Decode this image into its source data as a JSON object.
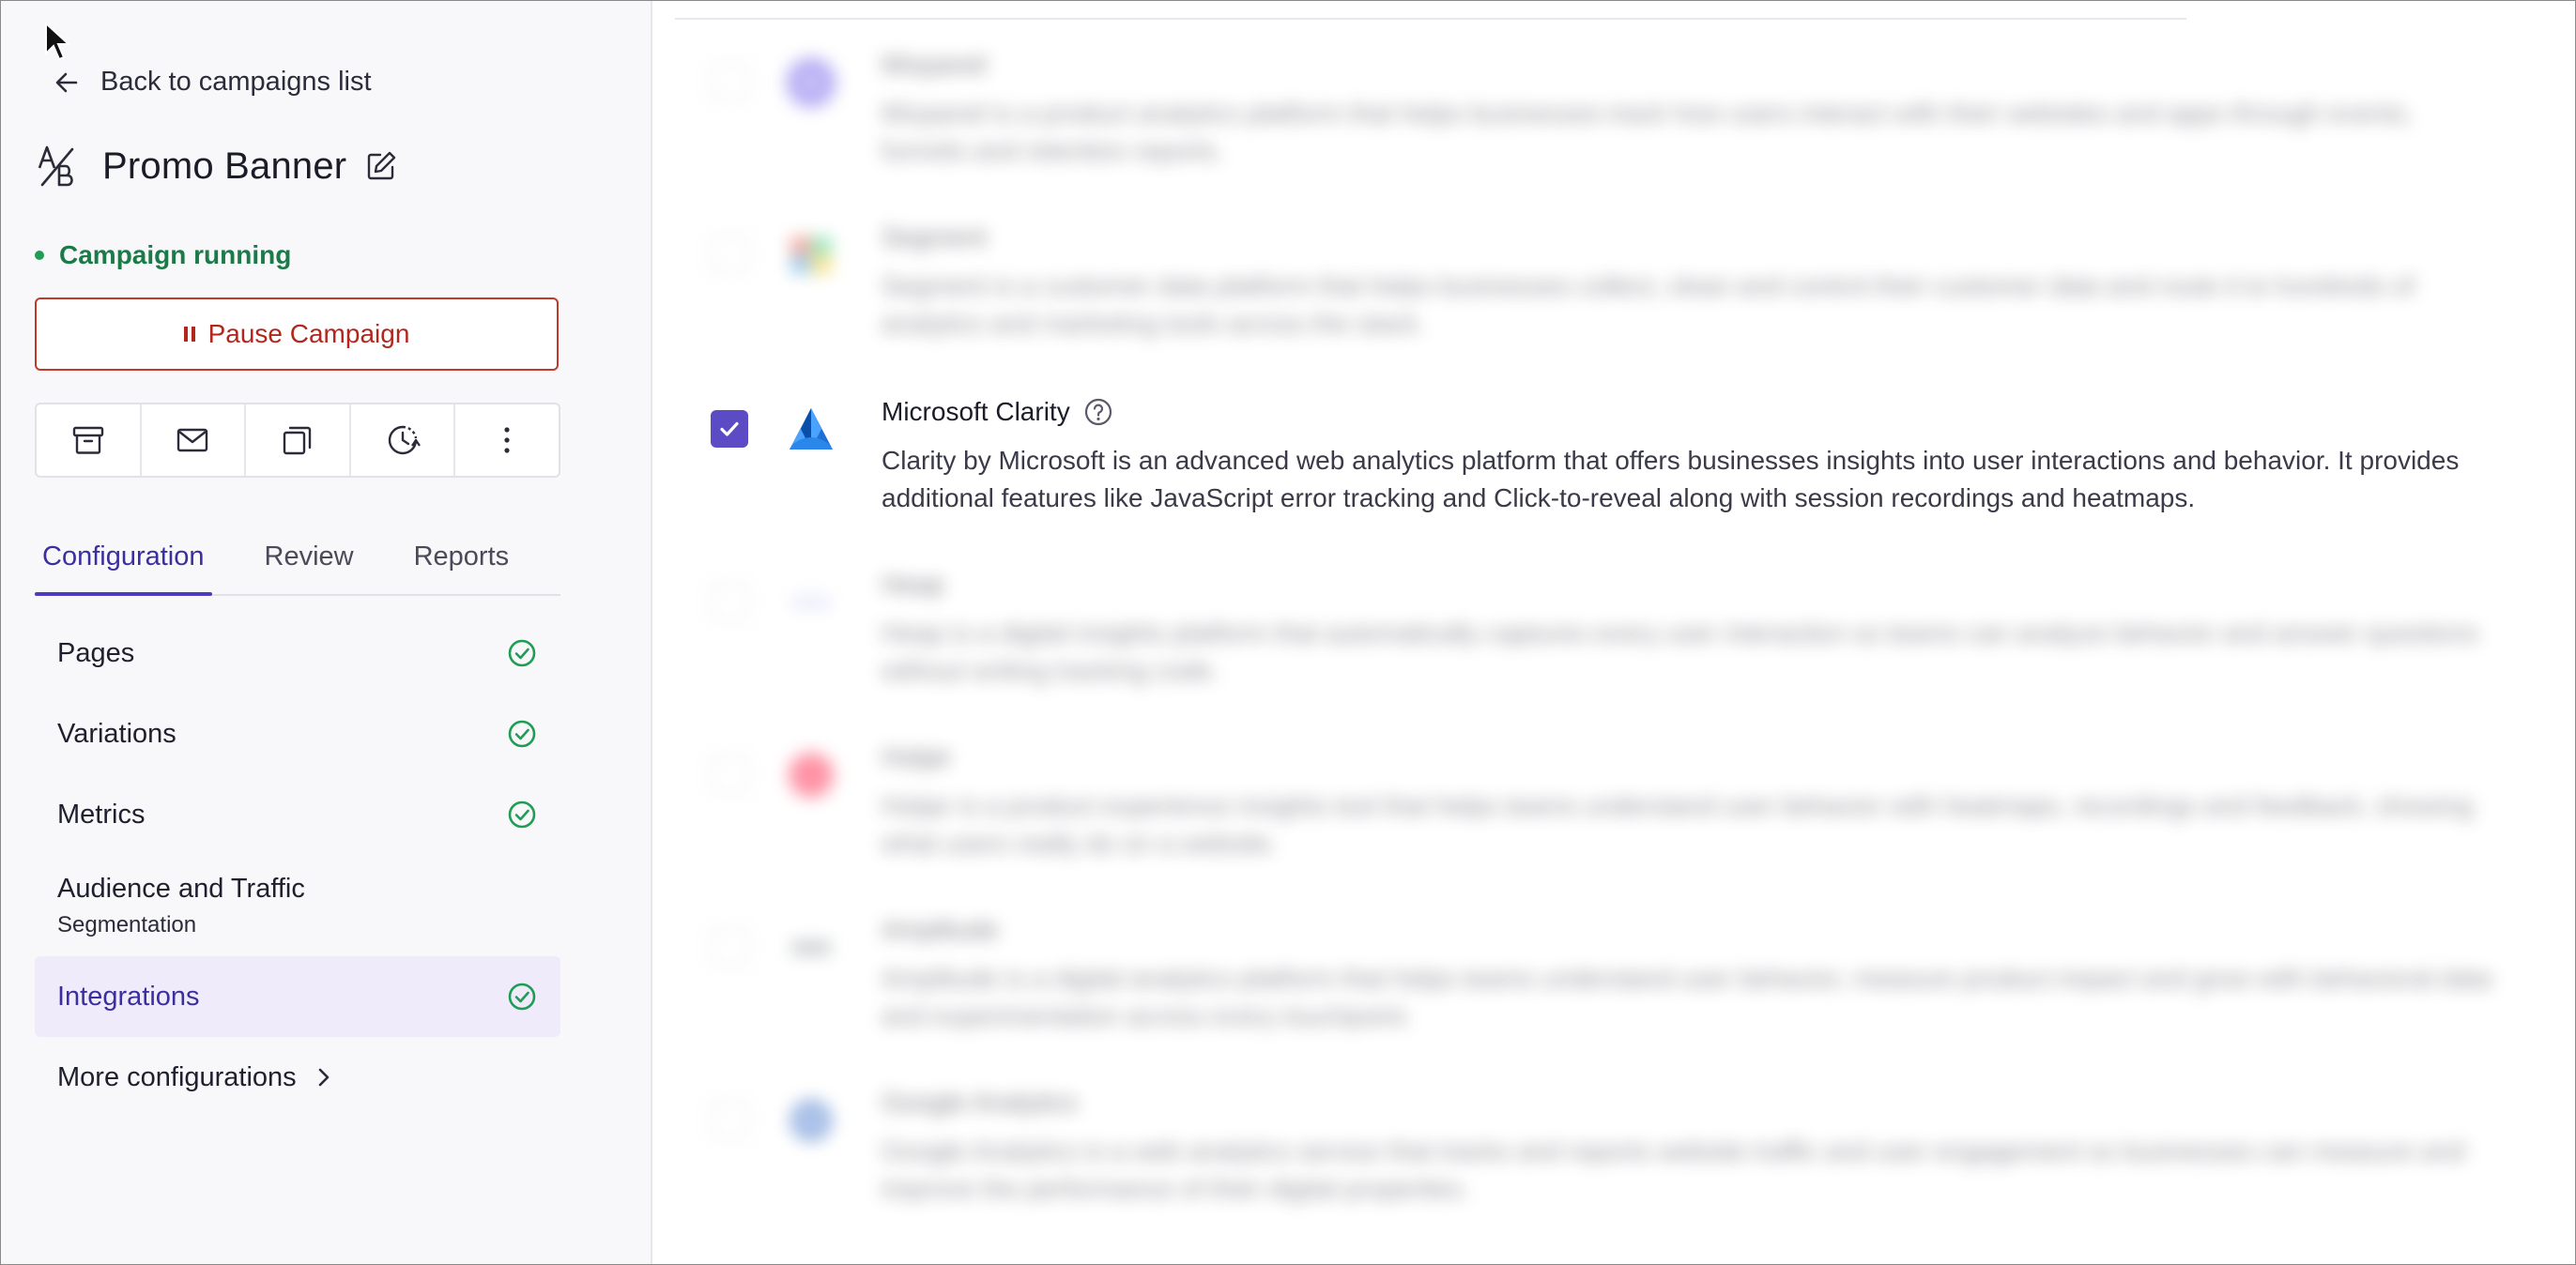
{
  "sidebar": {
    "back_label": "Back to campaigns list",
    "campaign_title": "Promo Banner",
    "status_text": "Campaign running",
    "pause_label": "Pause Campaign",
    "actions": [
      "archive-icon",
      "mail-icon",
      "duplicate-icon",
      "history-icon",
      "more-vertical-icon"
    ],
    "tabs": [
      {
        "label": "Configuration",
        "active": true
      },
      {
        "label": "Review",
        "active": false
      },
      {
        "label": "Reports",
        "active": false
      }
    ],
    "nav": [
      {
        "label": "Pages",
        "complete": true
      },
      {
        "label": "Variations",
        "complete": true
      },
      {
        "label": "Metrics",
        "complete": true
      },
      {
        "label": "Audience and Traffic",
        "sub": "Segmentation",
        "complete": false
      },
      {
        "label": "Integrations",
        "complete": true,
        "active": true
      },
      {
        "label": "More configurations"
      }
    ]
  },
  "integrations": [
    {
      "name": "Mixpanel",
      "description": "Mixpanel is a product analytics platform that helps businesses track how users interact with their websites and apps through events, funnels and retention reports.",
      "checked": false,
      "blurred": true,
      "logo_color": "#6c5ce7"
    },
    {
      "name": "Segment",
      "description": "Segment is a customer data platform that helps businesses collect, clean and control their customer data and route it to hundreds of analytics and marketing tools across the stack.",
      "checked": false,
      "blurred": true,
      "logo_color": "#52bd94"
    },
    {
      "name": "Microsoft Clarity",
      "description": "Clarity by Microsoft is an advanced web analytics platform that offers businesses insights into user interactions and behavior. It provides additional features like JavaScript error tracking and Click-to-reveal along with session recordings and heatmaps.",
      "checked": true,
      "blurred": false,
      "logo_color": "#1f6fd6"
    },
    {
      "name": "Heap",
      "description": "Heap is a digital insights platform that automatically captures every user interaction so teams can analyze behavior and answer questions without writing tracking code.",
      "checked": false,
      "blurred": true,
      "logo_color": "#c8cdf5"
    },
    {
      "name": "Hotjar",
      "description": "Hotjar is a product experience insights tool that helps teams understand user behavior with heatmaps, recordings and feedback, showing what users really do on a website.",
      "checked": false,
      "blurred": true,
      "logo_color": "#fd3a5c"
    },
    {
      "name": "Amplitude",
      "description": "Amplitude is a digital analytics platform that helps teams understand user behavior, measure product impact and grow with behavioral data and experimentation across every touchpoint.",
      "checked": false,
      "blurred": true,
      "logo_color": "#9aa0a6"
    },
    {
      "name": "Google Analytics",
      "description": "Google Analytics is a web analytics service that tracks and reports website traffic and user engagement so businesses can measure and improve the performance of their digital properties.",
      "checked": false,
      "blurred": true,
      "logo_color": "#3d6fc4"
    }
  ]
}
